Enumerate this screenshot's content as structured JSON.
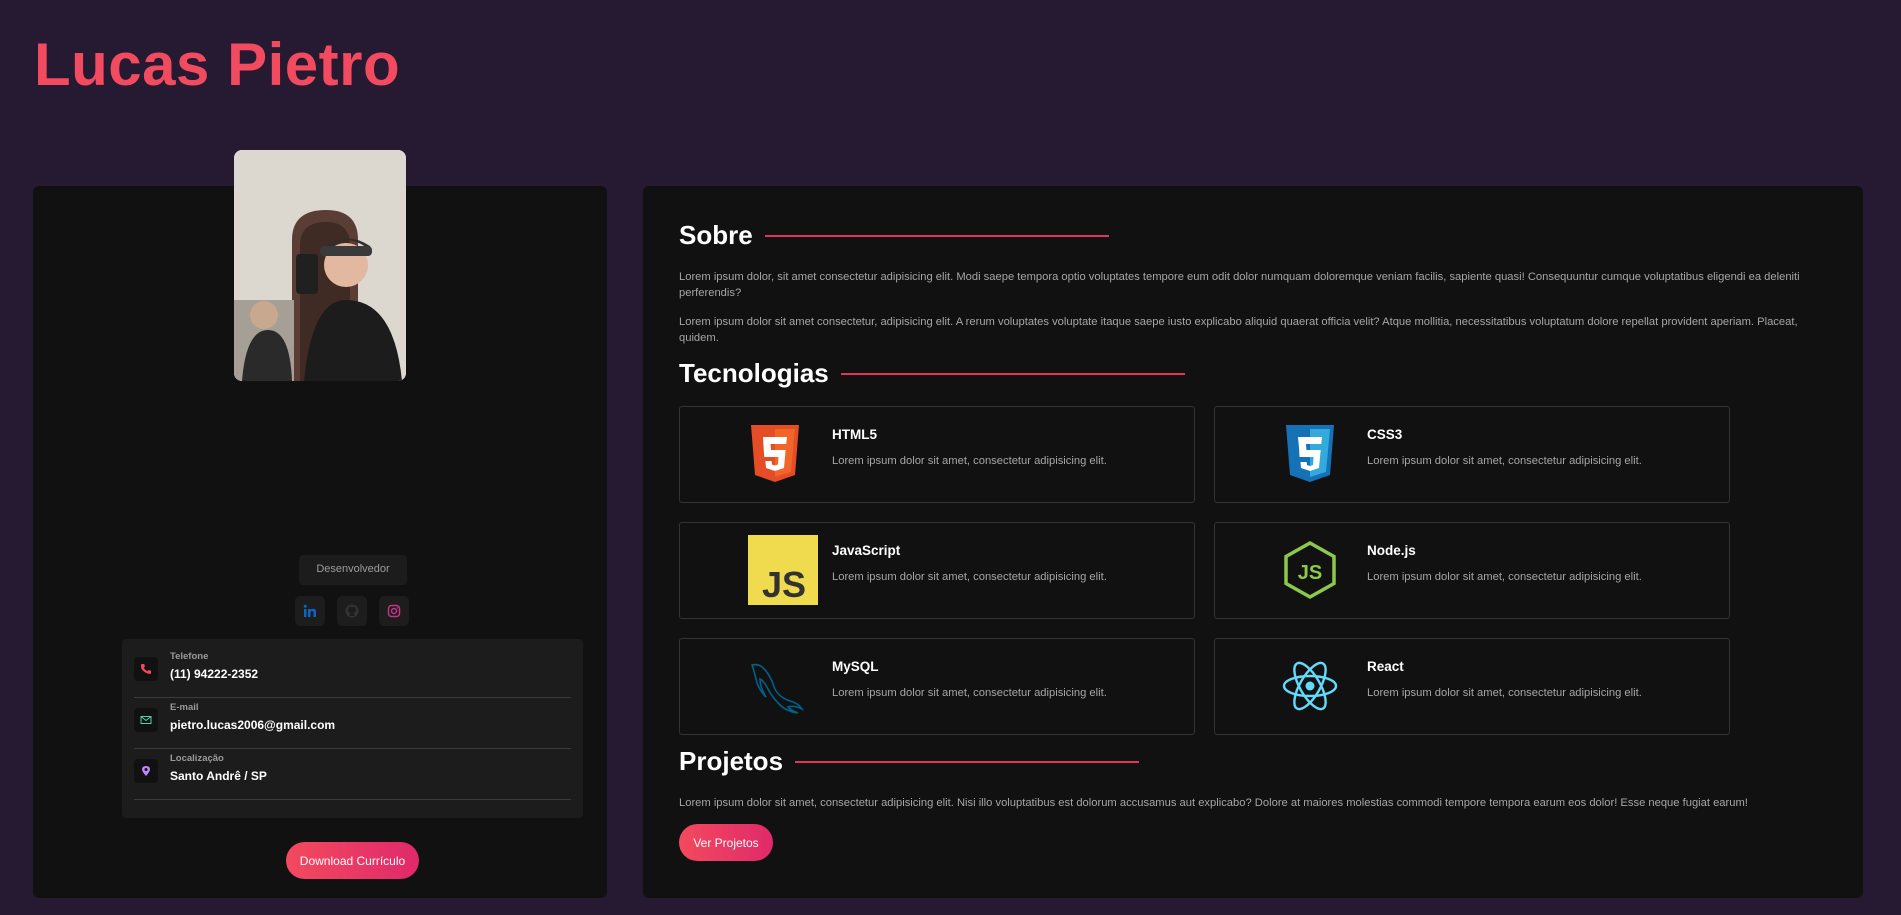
{
  "header": {
    "title": "Lucas Pietro"
  },
  "profile": {
    "role": "Desenvolvedor",
    "socials": [
      {
        "name": "linkedin",
        "icon": "linkedin-icon",
        "color": "#0a66c2"
      },
      {
        "name": "github",
        "icon": "github-icon",
        "color": "#333333"
      },
      {
        "name": "instagram",
        "icon": "instagram-icon",
        "color": "#c13584"
      }
    ],
    "contacts": [
      {
        "label": "Telefone",
        "value": "(11) 94222-2352",
        "icon": "phone-icon",
        "color": "#f24a5e"
      },
      {
        "label": "E-mail",
        "value": "pietro.lucas2006@gmail.com",
        "icon": "mail-icon",
        "color": "#4fd1b0"
      },
      {
        "label": "Localização",
        "value": "Santo Andrê / SP",
        "icon": "location-icon",
        "color": "#c084fc"
      }
    ],
    "download_label": "Download Currículo"
  },
  "about": {
    "title": "Sobre",
    "paragraphs": [
      "Lorem ipsum dolor, sit amet consectetur adipisicing elit. Modi saepe tempora optio voluptates tempore eum odit dolor numquam doloremque veniam facilis, sapiente quasi! Consequuntur cumque voluptatibus eligendi ea deleniti perferendis?",
      "Lorem ipsum dolor sit amet consectetur, adipisicing elit. A rerum voluptates voluptate itaque saepe iusto explicabo aliquid quaerat officia velit? Atque mollitia, necessitatibus voluptatum dolore repellat provident aperiam. Placeat, quidem."
    ]
  },
  "tech": {
    "title": "Tecnologias",
    "items": [
      {
        "name": "HTML5",
        "desc": "Lorem ipsum dolor sit amet, consectetur adipisicing elit.",
        "icon": "html5-icon"
      },
      {
        "name": "CSS3",
        "desc": "Lorem ipsum dolor sit amet, consectetur adipisicing elit.",
        "icon": "css3-icon"
      },
      {
        "name": "JavaScript",
        "desc": "Lorem ipsum dolor sit amet, consectetur adipisicing elit.",
        "icon": "javascript-icon"
      },
      {
        "name": "Node.js",
        "desc": "Lorem ipsum dolor sit amet, consectetur adipisicing elit.",
        "icon": "nodejs-icon"
      },
      {
        "name": "MySQL",
        "desc": "Lorem ipsum dolor sit amet, consectetur adipisicing elit.",
        "icon": "mysql-icon"
      },
      {
        "name": "React",
        "desc": "Lorem ipsum dolor sit amet, consectetur adipisicing elit.",
        "icon": "react-icon"
      }
    ]
  },
  "projects": {
    "title": "Projetos",
    "text": "Lorem ipsum dolor sit amet, consectetur adipisicing elit. Nisi illo voluptatibus est dolorum accusamus aut explicabo? Dolore at maiores molestias commodi tempore tempora earum eos dolor! Esse neque fugiat earum!",
    "button_label": "Ver Projetos"
  },
  "colors": {
    "accent": "#f24a5e",
    "background": "#261a33",
    "card": "#111111"
  }
}
